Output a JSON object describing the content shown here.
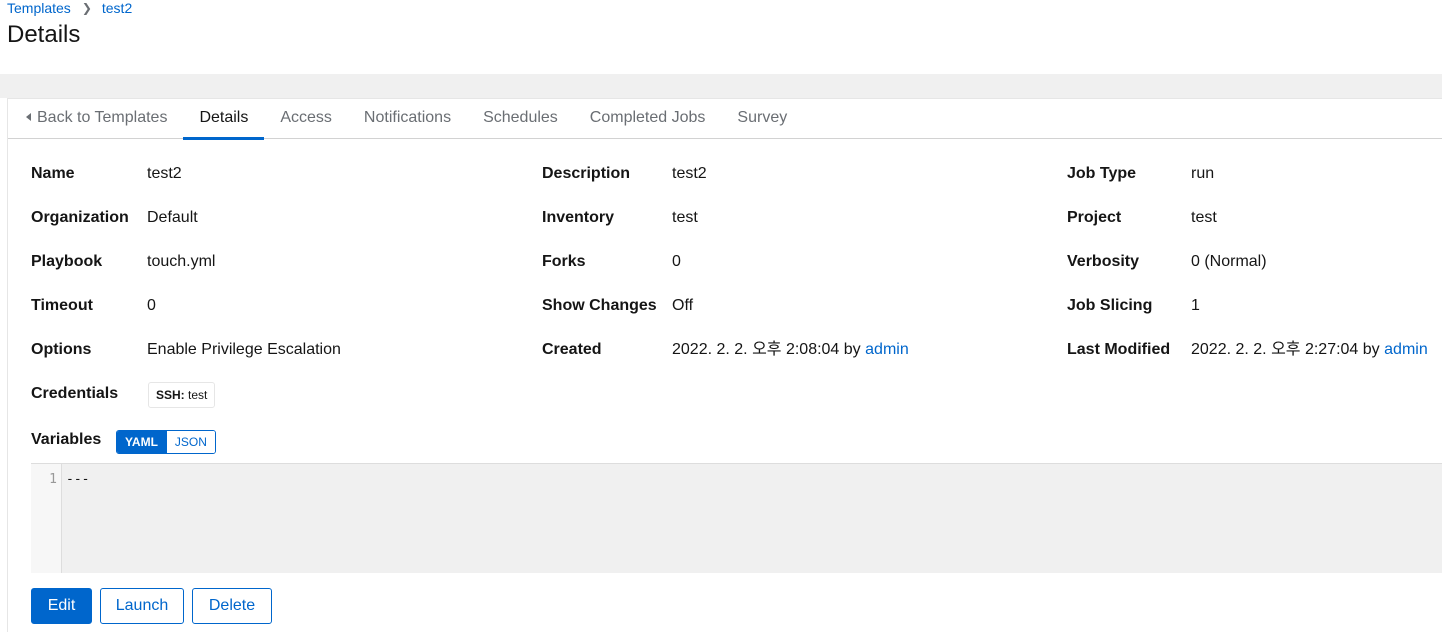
{
  "breadcrumb": {
    "parent": "Templates",
    "current": "test2"
  },
  "page_title": "Details",
  "tabs": {
    "back": "Back to Templates",
    "details": "Details",
    "access": "Access",
    "notifications": "Notifications",
    "schedules": "Schedules",
    "completed_jobs": "Completed Jobs",
    "survey": "Survey"
  },
  "details": {
    "name": {
      "label": "Name",
      "value": "test2"
    },
    "organization": {
      "label": "Organization",
      "value": "Default"
    },
    "playbook": {
      "label": "Playbook",
      "value": "touch.yml"
    },
    "timeout": {
      "label": "Timeout",
      "value": "0"
    },
    "options": {
      "label": "Options",
      "value": "Enable Privilege Escalation"
    },
    "credentials": {
      "label": "Credentials",
      "chip_type": "SSH:",
      "chip_value": "test"
    },
    "description": {
      "label": "Description",
      "value": "test2"
    },
    "inventory": {
      "label": "Inventory",
      "value": "test"
    },
    "forks": {
      "label": "Forks",
      "value": "0"
    },
    "show_changes": {
      "label": "Show Changes",
      "value": "Off"
    },
    "created": {
      "label": "Created",
      "value": "2022. 2. 2. 오후 2:08:04 by",
      "user": "admin"
    },
    "job_type": {
      "label": "Job Type",
      "value": "run"
    },
    "project": {
      "label": "Project",
      "value": "test"
    },
    "verbosity": {
      "label": "Verbosity",
      "value": "0 (Normal)"
    },
    "job_slicing": {
      "label": "Job Slicing",
      "value": "1"
    },
    "last_modified": {
      "label": "Last Modified",
      "value": "2022. 2. 2. 오후 2:27:04 by",
      "user": "admin"
    }
  },
  "variables": {
    "label": "Variables",
    "yaml": "YAML",
    "json": "JSON",
    "line_number": "1",
    "content": "---"
  },
  "buttons": {
    "edit": "Edit",
    "launch": "Launch",
    "delete": "Delete"
  },
  "colors": {
    "accent": "#0066cc",
    "editor_bg": "#f0f0f0"
  },
  "icons": {
    "breadcrumb_separator": "chevron-right-icon",
    "back": "caret-left-icon"
  }
}
